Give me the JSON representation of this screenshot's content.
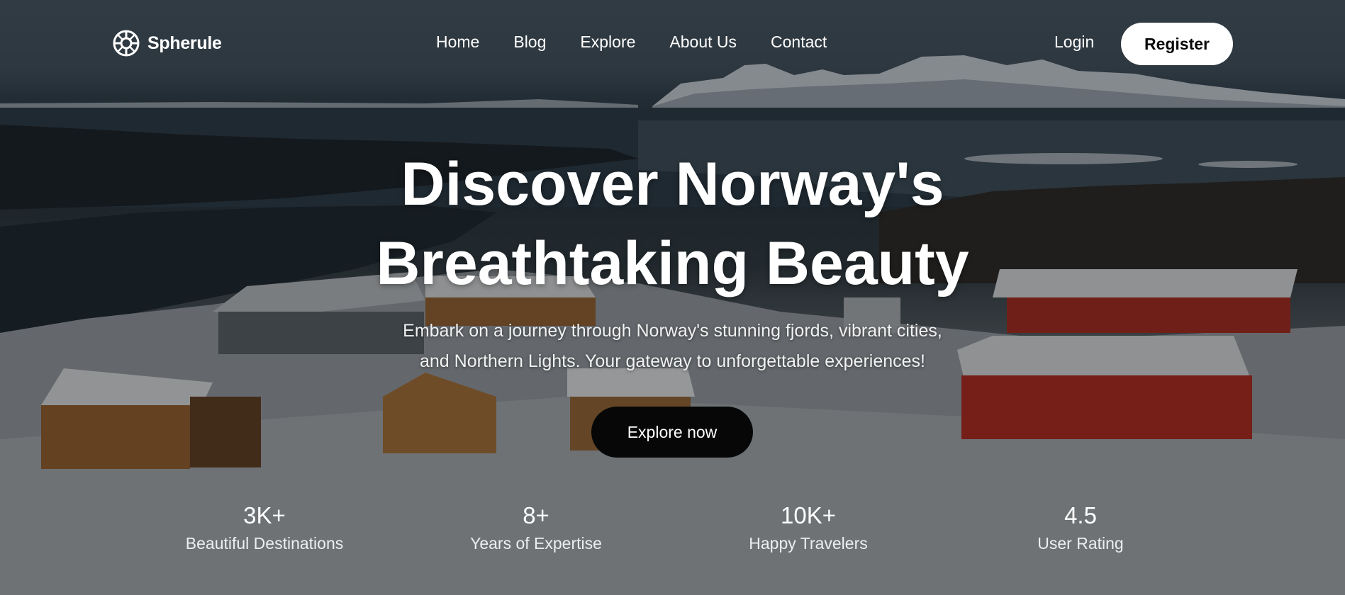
{
  "brand": {
    "name": "Spherule",
    "icon": "sphere-logo-icon"
  },
  "nav": {
    "links": [
      "Home",
      "Blog",
      "Explore",
      "About Us",
      "Contact"
    ],
    "login_label": "Login",
    "register_label": "Register"
  },
  "hero": {
    "headline_line1": "Discover Norway's",
    "headline_line2": "Breathtaking Beauty",
    "subtitle_line1": "Embark on a journey through Norway's stunning fjords, vibrant cities,",
    "subtitle_line2": "and Northern Lights. Your gateway to unforgettable experiences!",
    "cta_label": "Explore now",
    "background": "snowy Norwegian village beside a fjord with snow-capped mountains"
  },
  "stats": [
    {
      "value": "3K+",
      "label": "Beautiful Destinations"
    },
    {
      "value": "8+",
      "label": "Years of Expertise"
    },
    {
      "value": "10K+",
      "label": "Happy Travelers"
    },
    {
      "value": "4.5",
      "label": "User Rating"
    }
  ],
  "colors": {
    "cta_background": "#070707",
    "register_background": "#ffffff",
    "text": "#ffffff"
  }
}
